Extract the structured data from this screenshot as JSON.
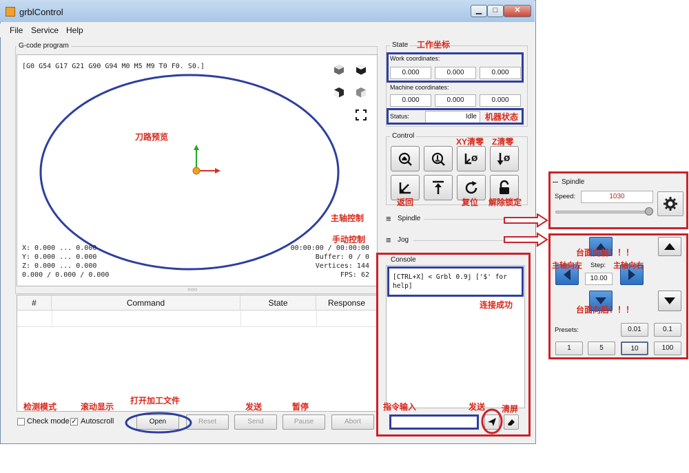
{
  "window": {
    "title": "grblControl",
    "minimize": "▁",
    "maximize": "□",
    "close": "✕"
  },
  "menu": {
    "file": "File",
    "service": "Service",
    "help": "Help"
  },
  "gcode": {
    "group_title": "G-code program",
    "state_line": "[G0 G54 G17 G21 G90 G94 M0 M5 M9 T0 F0. S0.]",
    "x": "X: 0.000 ... 0.000",
    "y": "Y: 0.000 ... 0.000",
    "z": "Z: 0.000 ... 0.000",
    "xyz": "0.000 / 0.000 / 0.000",
    "time": "00:00:00 / 00:00:00",
    "buffer": "Buffer: 0 / 0",
    "vertices": "Vertices: 144",
    "fps": "FPS: 62",
    "splitter": "○○○"
  },
  "table": {
    "columns": [
      "#",
      "Command",
      "State",
      "Response"
    ]
  },
  "bottom": {
    "check_mode": "Check mode",
    "autoscroll": "Autoscroll",
    "open": "Open",
    "reset": "Reset",
    "send": "Send",
    "pause": "Pause",
    "abort": "Abort"
  },
  "state": {
    "title": "State",
    "work_label": "Work coordinates:",
    "work": [
      "0.000",
      "0.000",
      "0.000"
    ],
    "machine_label": "Machine coordinates:",
    "machine": [
      "0.000",
      "0.000",
      "0.000"
    ],
    "status_label": "Status:",
    "status_value": "Idle"
  },
  "control": {
    "title": "Control"
  },
  "sections": {
    "spindle": "Spindle",
    "jog": "Jog",
    "console": "Console"
  },
  "console": {
    "message": "[CTRL+X] < Grbl 0.9j ['$' for help]"
  },
  "spindle_panel": {
    "title": "Spindle",
    "speed_label": "Speed:",
    "speed_value": "1030",
    "slider_level": 0.97
  },
  "jog_panel": {
    "step_label": "Step:",
    "step_value": "10.00",
    "presets_label": "Presets:",
    "presets_top": [
      "0.01",
      "0.1"
    ],
    "presets_bottom": [
      "1",
      "5",
      "10",
      "100"
    ]
  },
  "annotations": {
    "work_coords": "工作坐标",
    "machine_state": "机器状态",
    "toolpath": "刀路预览",
    "xy_zero": "XY清零",
    "z_zero": "Z清零",
    "return": "返回",
    "reset": "复位",
    "unlock": "解除锁定",
    "spindle_ctrl": "主轴控制",
    "manual_ctrl": "手动控制",
    "connected": "连接成功",
    "check_mode": "检测模式",
    "autoscroll": "滚动显示",
    "open_file": "打开加工文件",
    "send": "发送",
    "pause": "暂停",
    "cmd_input": "指令输入",
    "send2": "发送",
    "clear": "清屏",
    "table_front": "台面向前！！！",
    "spindle_left": "主轴向左",
    "spindle_right": "主轴向右",
    "table_back": "台面向后！！！"
  }
}
